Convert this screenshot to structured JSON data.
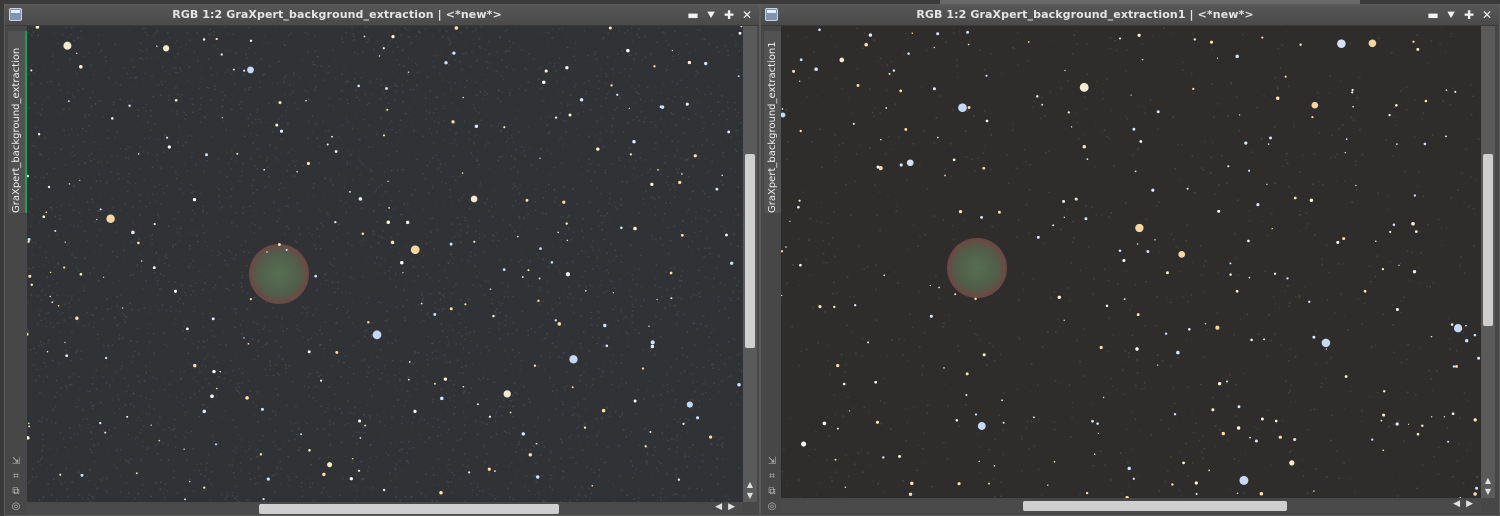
{
  "windows": [
    {
      "title": "RGB 1:2 GraXpert_background_extraction | <*new*>",
      "side_tab": "GraXpert_background_extraction",
      "buttons": {
        "minimize": "▬",
        "shade": "⯆",
        "maximize": "✚",
        "close": "✕"
      }
    },
    {
      "title": "RGB 1:2 GraXpert_background_extraction1 | <*new*>",
      "side_tab": "GraXpert_background_extraction1",
      "buttons": {
        "minimize": "▬",
        "shade": "⯆",
        "maximize": "✚",
        "close": "✕"
      }
    }
  ],
  "tool_icons": [
    "zoom-fit-icon",
    "resize-icon",
    "clone-icon",
    "target-icon"
  ],
  "scroll_arrows": {
    "up": "▲",
    "down": "▼",
    "left": "◀",
    "right": "▶"
  },
  "colors": {
    "accent_tab": "#1e9e5c",
    "titlebar": "#4f4f4f",
    "sky1": "#2f3032",
    "sky2": "#2d2c2a"
  }
}
